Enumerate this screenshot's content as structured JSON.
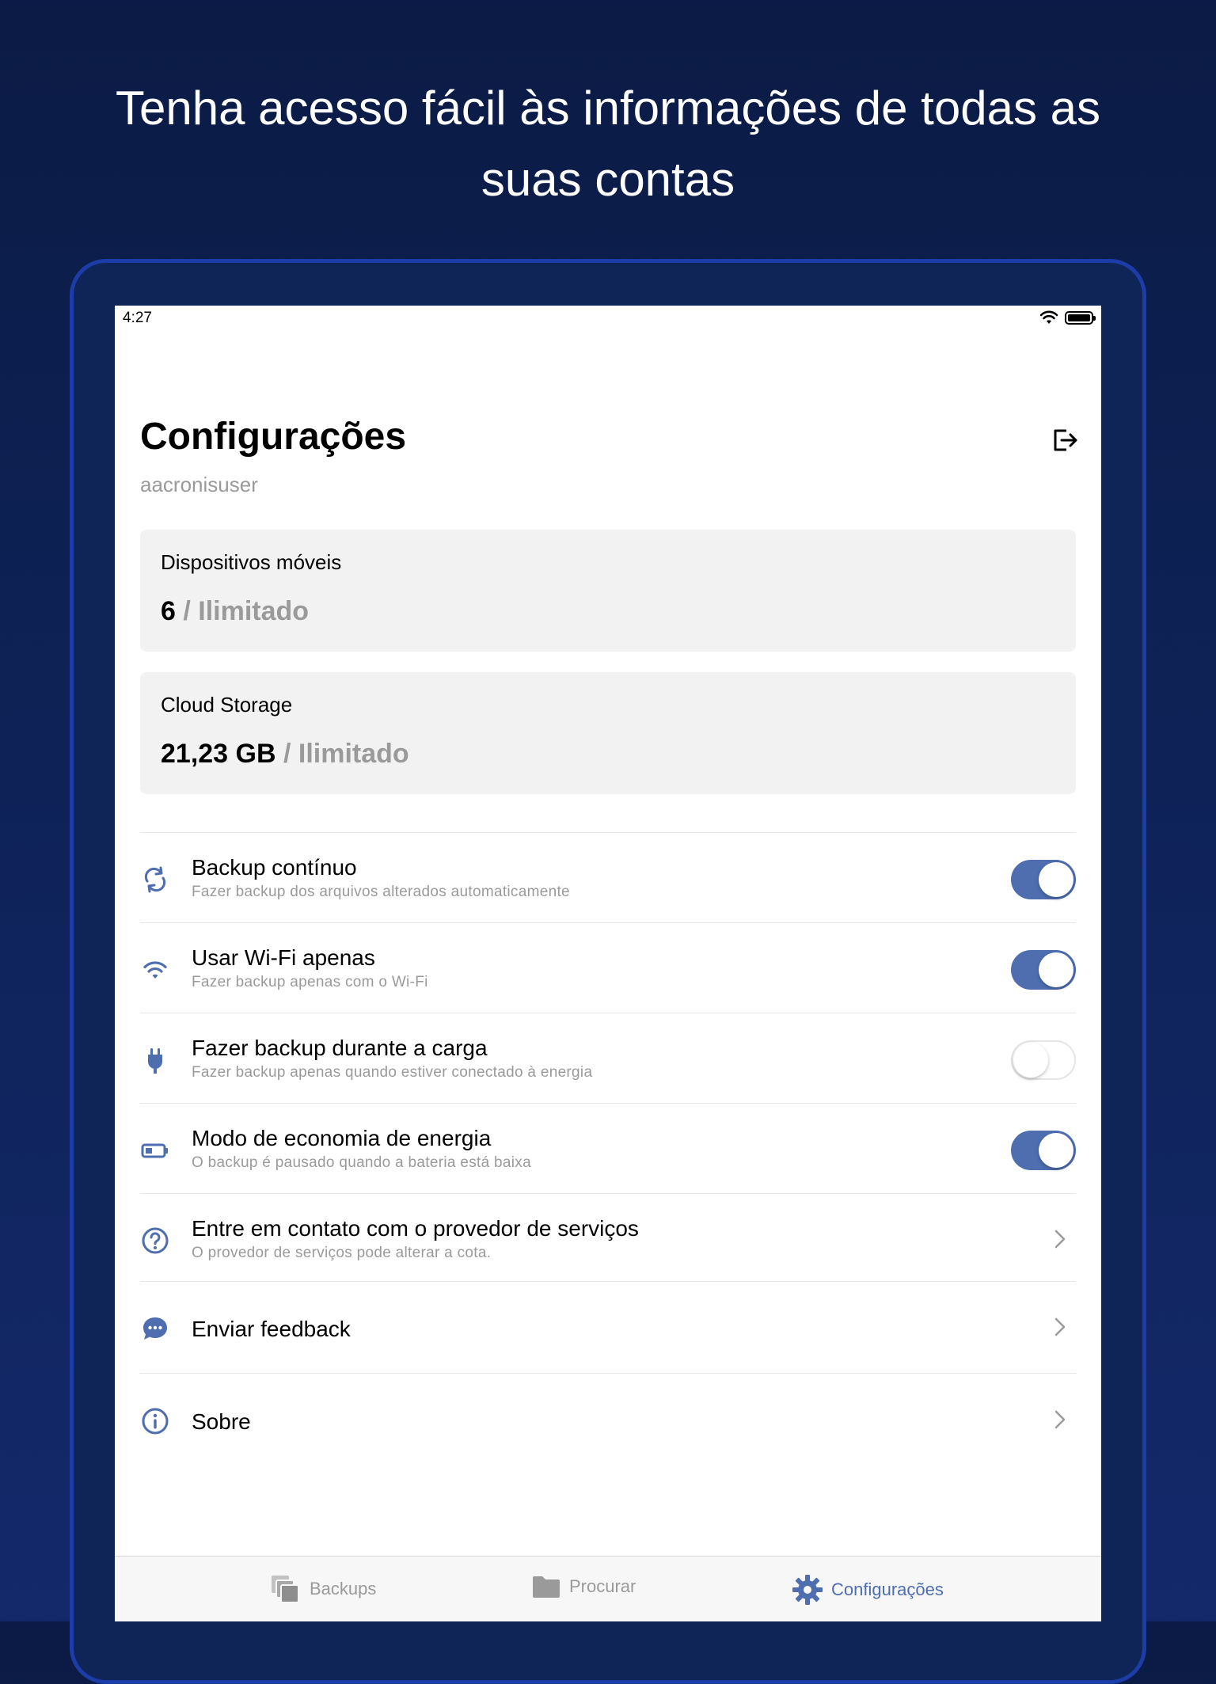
{
  "headline": {
    "line1": "Tenha acesso fácil às informações de todas as",
    "line2": "suas contas"
  },
  "status_bar": {
    "time": "4:27"
  },
  "header": {
    "title": "Configurações",
    "username": "aacronisuser",
    "logout_icon": "logout-icon"
  },
  "cards": [
    {
      "label": "Dispositivos móveis",
      "used": "6",
      "limit": "/ Ilimitado"
    },
    {
      "label": "Cloud Storage",
      "used": "21,23 GB",
      "limit": "/ Ilimitado"
    }
  ],
  "settings": [
    {
      "icon": "sync-icon",
      "label": "Backup contínuo",
      "sub": "Fazer backup dos arquivos alterados automaticamente",
      "toggle": true
    },
    {
      "icon": "wifi-icon",
      "label": "Usar Wi-Fi apenas",
      "sub": "Fazer backup apenas com o Wi-Fi",
      "toggle": true
    },
    {
      "icon": "plug-icon",
      "label": "Fazer backup durante a carga",
      "sub": "Fazer backup apenas quando estiver conectado à energia",
      "toggle": false
    },
    {
      "icon": "battery-low-icon",
      "label": "Modo de economia de energia",
      "sub": "O backup é pausado quando a bateria está baixa",
      "toggle": true
    },
    {
      "icon": "help-circle-icon",
      "label": "Entre em contato com o provedor de serviços",
      "sub": "O provedor de serviços pode alterar a cota."
    },
    {
      "icon": "feedback-icon",
      "label": "Enviar feedback"
    },
    {
      "icon": "info-icon",
      "label": "Sobre"
    }
  ],
  "tabbar": {
    "tabs": [
      {
        "icon": "backups-icon",
        "label": "Backups",
        "active": false
      },
      {
        "icon": "folder-icon",
        "label": "Procurar",
        "active": false
      },
      {
        "icon": "gear-icon",
        "label": "Configurações",
        "active": true
      }
    ]
  },
  "colors": {
    "accent": "#4e6eb0",
    "background_top": "#0b1b45",
    "background_bottom": "#13296a",
    "frame": "#1c3da8"
  }
}
